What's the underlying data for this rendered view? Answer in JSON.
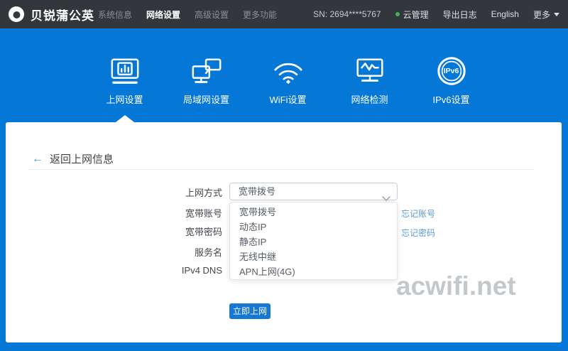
{
  "topbar": {
    "brand": "贝锐蒲公英",
    "menu": [
      "系统信息",
      "网络设置",
      "高级设置",
      "更多功能"
    ],
    "active_menu": "网络设置",
    "sn_text": "SN:  2694****5767",
    "cloud_manage": "云管理",
    "export_log": "导出日志",
    "language": "English",
    "more": "更多"
  },
  "banner": {
    "tabs": [
      "上网设置",
      "局域网设置",
      "WiFi设置",
      "网络检测",
      "IPv6设置"
    ],
    "active_tab": "上网设置",
    "ipv6_icon_text": "IPv6"
  },
  "card": {
    "back_link": "返回上网信息",
    "form": {
      "mode_label": "上网方式",
      "mode_value": "宽带拨号",
      "account_label": "宽带账号",
      "password_label": "宽带密码",
      "service_label": "服务名",
      "dns_label": "IPv4 DNS",
      "forgot_account": "忘记账号",
      "forgot_password": "忘记密码",
      "options": [
        "宽带拨号",
        "动态IP",
        "静态IP",
        "无线中继",
        "APN上网(4G)"
      ],
      "submit": "立即上网"
    },
    "watermark": "acwifi.net"
  },
  "colors": {
    "topbar_bg": "#33363b",
    "banner_blue": "#0477d7",
    "button_blue": "#1677d4",
    "link_blue": "#5b9bd5",
    "status_green": "#3eb54a"
  }
}
